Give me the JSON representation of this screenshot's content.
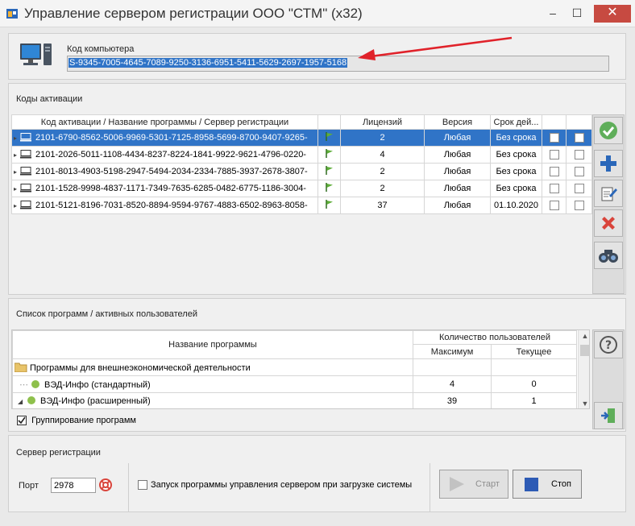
{
  "window": {
    "title": "Управление сервером регистрации ООО \"СТМ\" (x32)",
    "minimize": "–",
    "maximize": "☐",
    "close": "✕"
  },
  "computer": {
    "label": "Код компьютера",
    "code": "S-9345-7005-4645-7089-9250-3136-6951-5411-5629-2697-1957-5168"
  },
  "activations": {
    "title": "Коды активации",
    "columns": [
      "Код активации / Название программы / Сервер регистрации",
      "Лицензий",
      "Версия",
      "Срок дей..."
    ],
    "rows": [
      {
        "code": "2101-6790-8562-5006-9969-5301-7125-8958-5699-8700-9407-9265-",
        "licenses": "2",
        "version": "Любая",
        "expiry": "Без срока",
        "selected": true
      },
      {
        "code": "2101-2026-5011-1108-4434-8237-8224-1841-9922-9621-4796-0220-",
        "licenses": "4",
        "version": "Любая",
        "expiry": "Без срока",
        "selected": false
      },
      {
        "code": "2101-8013-4903-5198-2947-5494-2034-2334-7885-3937-2678-3807-",
        "licenses": "2",
        "version": "Любая",
        "expiry": "Без срока",
        "selected": false
      },
      {
        "code": "2101-1528-9998-4837-1171-7349-7635-6285-0482-6775-1186-3004-",
        "licenses": "2",
        "version": "Любая",
        "expiry": "Без срока",
        "selected": false
      },
      {
        "code": "2101-5121-8196-7031-8520-8894-9594-9767-4883-6502-8963-8058-",
        "licenses": "37",
        "version": "Любая",
        "expiry": "01.10.2020",
        "selected": false
      }
    ]
  },
  "programs": {
    "title": "Список программ / активных пользователей",
    "col_name": "Название программы",
    "col_users": "Количество пользователей",
    "col_max": "Максимум",
    "col_current": "Текущее",
    "group_name": "Программы для внешнеэкономической деятельности",
    "items": [
      {
        "name": "ВЭД-Инфо (стандартный)",
        "max": "4",
        "current": "0"
      },
      {
        "name": "ВЭД-Инфо (расширенный)",
        "max": "39",
        "current": "1"
      }
    ],
    "grouping_label": "Группирование программ",
    "grouping_checked": true
  },
  "server": {
    "title": "Сервер регистрации",
    "port_label": "Порт",
    "port_value": "2978",
    "autostart_label": "Запуск программы управления сервером при загрузке системы",
    "start_label": "Старт",
    "stop_label": "Стоп"
  },
  "colors": {
    "selection": "#3074c7",
    "close_button": "#c74a41",
    "arrow": "#e0222a",
    "stop_icon": "#2d5bb5"
  }
}
